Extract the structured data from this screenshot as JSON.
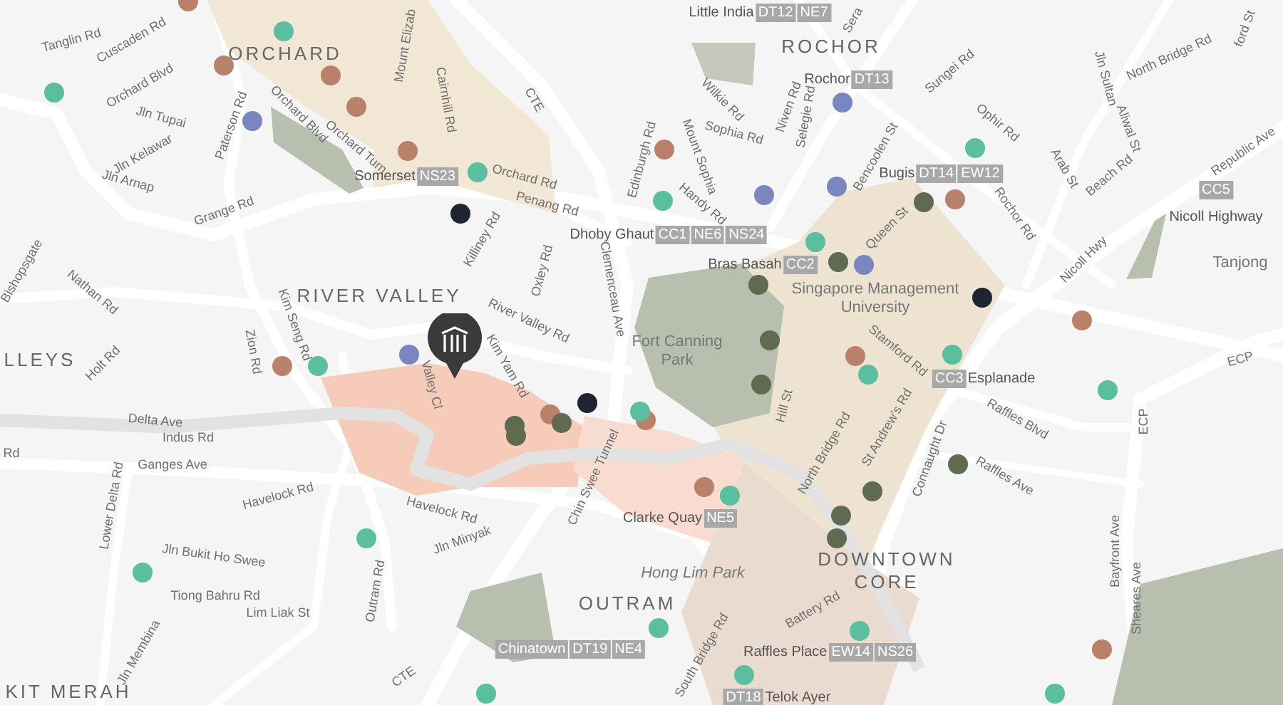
{
  "districts": [
    {
      "text": "ORCHARD"
    },
    {
      "text": "ROCHOR"
    },
    {
      "text": "RIVER VALLEY"
    },
    {
      "text": "LLEYS"
    },
    {
      "text": "OUTRAM"
    },
    {
      "text": "DOWNTOWN CORE"
    },
    {
      "text": "KIT MERAH"
    }
  ],
  "places": [
    {
      "text": "Singapore Management University"
    },
    {
      "text": "Fort Canning Park"
    },
    {
      "text": "Hong Lim Park"
    },
    {
      "text": "Tanjong"
    }
  ],
  "stations": [
    {
      "name": "Little India",
      "kind": "after",
      "boxed": false,
      "codes": [
        "DT12",
        "NE7"
      ]
    },
    {
      "name": "Rochor",
      "kind": "after",
      "boxed": false,
      "codes": [
        "DT13"
      ]
    },
    {
      "name": "Somerset",
      "kind": "after",
      "boxed": false,
      "codes": [
        "NS23"
      ]
    },
    {
      "name": "Bugis",
      "kind": "after",
      "boxed": false,
      "codes": [
        "DT14",
        "EW12"
      ]
    },
    {
      "name": "Dhoby Ghaut",
      "kind": "after",
      "boxed": false,
      "codes": [
        "CC1",
        "NE6",
        "NS24"
      ]
    },
    {
      "name": "Bras Basah",
      "kind": "after",
      "boxed": false,
      "codes": [
        "CC2"
      ]
    },
    {
      "name": "Nicoll Highway",
      "kind": "above",
      "boxed": false,
      "codes": [
        "CC5"
      ]
    },
    {
      "name": "Esplanade",
      "kind": "before",
      "boxed": false,
      "codes": [
        "CC3"
      ]
    },
    {
      "name": "Clarke Quay",
      "kind": "after",
      "boxed": false,
      "codes": [
        "NE5"
      ]
    },
    {
      "name": "Chinatown",
      "kind": "after",
      "boxed": true,
      "codes": [
        "DT19",
        "NE4"
      ]
    },
    {
      "name": "Raffles Place",
      "kind": "after",
      "boxed": false,
      "codes": [
        "EW14",
        "NS26"
      ]
    },
    {
      "name": "Telok Ayer",
      "kind": "before",
      "boxed": false,
      "codes": [
        "DT18"
      ]
    }
  ],
  "road_labels": [
    {
      "text": "Tanglin Rd"
    },
    {
      "text": "Cuscaden Rd"
    },
    {
      "text": "Orchard Blvd"
    },
    {
      "text": "Jln Tupai"
    },
    {
      "text": "Jln Kelawar"
    },
    {
      "text": "Jln Arnap"
    },
    {
      "text": "Paterson Rd"
    },
    {
      "text": "Orchard Blvd"
    },
    {
      "text": "Orchard Turn"
    },
    {
      "text": "Mount Elizab"
    },
    {
      "text": "Cairnhill Rd"
    },
    {
      "text": "CTE"
    },
    {
      "text": "Orchard Rd"
    },
    {
      "text": "Penang Rd"
    },
    {
      "text": "Edinburgh Rd"
    },
    {
      "text": "Mount Sophia"
    },
    {
      "text": "Wilkie Rd"
    },
    {
      "text": "Sophia Rd"
    },
    {
      "text": "Niven Rd"
    },
    {
      "text": "Selegie Rd"
    },
    {
      "text": "Handy Rd"
    },
    {
      "text": "Killiney Rd"
    },
    {
      "text": "Oxley Rd"
    },
    {
      "text": "Clemenceau Ave"
    },
    {
      "text": "River Valley Rd"
    },
    {
      "text": "Grange Rd"
    },
    {
      "text": "Bishopsgate"
    },
    {
      "text": "Nathan Rd"
    },
    {
      "text": "Holt Rd"
    },
    {
      "text": "Zion Rd"
    },
    {
      "text": "Kim Seng Rd"
    },
    {
      "text": "Kim Yam Rd"
    },
    {
      "text": "Valley Cl"
    },
    {
      "text": "Delta Ave"
    },
    {
      "text": "Indus Rd"
    },
    {
      "text": "Ganges Ave"
    },
    {
      "text": "Havelock Rd"
    },
    {
      "text": "Havelock Rd"
    },
    {
      "text": "Lower Delta Rd"
    },
    {
      "text": "Jln Bukit Ho Swee"
    },
    {
      "text": "Tiong Bahru Rd"
    },
    {
      "text": "Lim Liak St"
    },
    {
      "text": "Jln Membina"
    },
    {
      "text": "Outram Rd"
    },
    {
      "text": "CTE"
    },
    {
      "text": "Jln Minyak"
    },
    {
      "text": "Chin Swee Tunnel"
    },
    {
      "text": "South Bridge Rd"
    },
    {
      "text": "Battery Rd"
    },
    {
      "text": "Hill St"
    },
    {
      "text": "North Bridge Rd"
    },
    {
      "text": "Stamford Rd"
    },
    {
      "text": "St Andrew's Rd"
    },
    {
      "text": "Connaught Dr"
    },
    {
      "text": "Raffles Ave"
    },
    {
      "text": "Raffles Blvd"
    },
    {
      "text": "Bayfront Ave"
    },
    {
      "text": "Sheares Ave"
    },
    {
      "text": "ECP"
    },
    {
      "text": "ECP"
    },
    {
      "text": "Queen St"
    },
    {
      "text": "Bencoolen St"
    },
    {
      "text": "Sungei Rd"
    },
    {
      "text": "Ophir Rd"
    },
    {
      "text": "Rochor Rd"
    },
    {
      "text": "Arab St"
    },
    {
      "text": "Beach Rd"
    },
    {
      "text": "Jln Sultan"
    },
    {
      "text": "Aliwal St"
    },
    {
      "text": "North Bridge Rd"
    },
    {
      "text": "Republic Ave"
    },
    {
      "text": "Nicoll Hwy"
    },
    {
      "text": "Sera"
    },
    {
      "text": "ford St"
    },
    {
      "text": "Rd"
    }
  ],
  "pins": [
    {
      "color": "#b9806a"
    },
    {
      "color": "#b9806a"
    },
    {
      "color": "#b9806a"
    },
    {
      "color": "#b9806a"
    },
    {
      "color": "#b9806a"
    },
    {
      "color": "#b9806a"
    },
    {
      "color": "#b9806a"
    },
    {
      "color": "#b9806a"
    },
    {
      "color": "#b9806a"
    },
    {
      "color": "#b9806a"
    },
    {
      "color": "#b9806a"
    },
    {
      "color": "#b9806a"
    },
    {
      "color": "#b9806a"
    },
    {
      "color": "#b9806a"
    },
    {
      "color": "#5bbf9f"
    },
    {
      "color": "#5bbf9f"
    },
    {
      "color": "#5bbf9f"
    },
    {
      "color": "#5bbf9f"
    },
    {
      "color": "#5bbf9f"
    },
    {
      "color": "#5bbf9f"
    },
    {
      "color": "#5bbf9f"
    },
    {
      "color": "#5bbf9f"
    },
    {
      "color": "#5bbf9f"
    },
    {
      "color": "#5bbf9f"
    },
    {
      "color": "#5bbf9f"
    },
    {
      "color": "#5bbf9f"
    },
    {
      "color": "#5bbf9f"
    },
    {
      "color": "#5bbf9f"
    },
    {
      "color": "#5bbf9f"
    },
    {
      "color": "#5bbf9f"
    },
    {
      "color": "#5bbf9f"
    },
    {
      "color": "#5bbf9f"
    },
    {
      "color": "#5bbf9f"
    },
    {
      "color": "#7a86c0"
    },
    {
      "color": "#7a86c0"
    },
    {
      "color": "#7a86c0"
    },
    {
      "color": "#7a86c0"
    },
    {
      "color": "#7a86c0"
    },
    {
      "color": "#7a86c0"
    },
    {
      "color": "#1f2433"
    },
    {
      "color": "#1f2433"
    },
    {
      "color": "#1f2433"
    },
    {
      "color": "#5f6b50"
    },
    {
      "color": "#5f6b50"
    },
    {
      "color": "#5f6b50"
    },
    {
      "color": "#5f6b50"
    },
    {
      "color": "#5f6b50"
    },
    {
      "color": "#5f6b50"
    },
    {
      "color": "#5f6b50"
    },
    {
      "color": "#5f6b50"
    },
    {
      "color": "#5f6b50"
    },
    {
      "color": "#5f6b50"
    },
    {
      "color": "#5f6b50"
    },
    {
      "color": "#5f6b50"
    }
  ]
}
